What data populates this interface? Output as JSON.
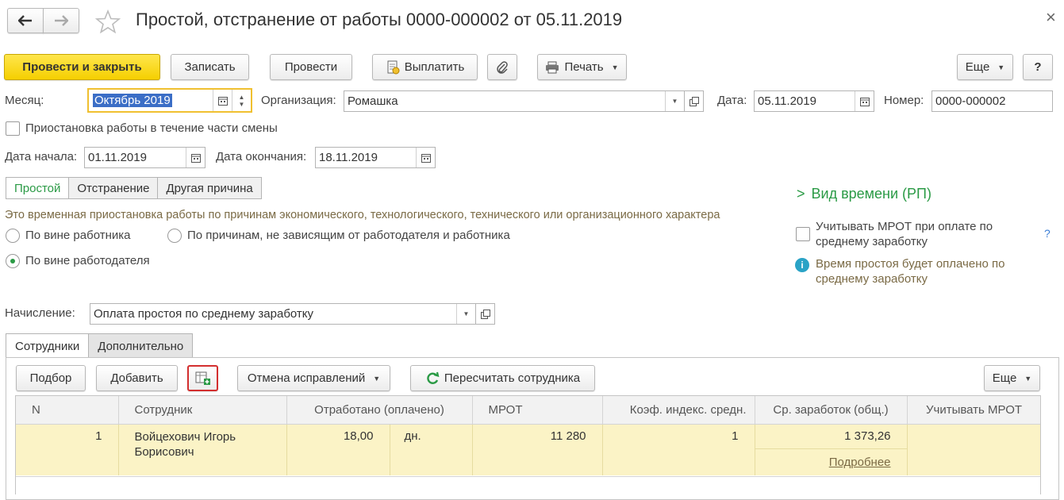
{
  "window": {
    "title": "Простой, отстранение от работы 0000-000002 от 05.11.2019",
    "back_icon": "arrow-left-icon",
    "forward_icon": "arrow-right-icon",
    "favorite_icon": "star-icon",
    "close_symbol": "×"
  },
  "toolbar": {
    "post_close": "Провести и закрыть",
    "save": "Записать",
    "post": "Провести",
    "pay": "Выплатить",
    "print": "Печать",
    "more": "Еще",
    "help": "?"
  },
  "form": {
    "month_label": "Месяц:",
    "month_value": "Октябрь 2019",
    "org_label": "Организация:",
    "org_value": "Ромашка",
    "date_label": "Дата:",
    "date_value": "05.11.2019",
    "number_label": "Номер:",
    "number_value": "0000-000002",
    "partial_shift_label": "Приостановка работы в течение части смены",
    "start_label": "Дата начала:",
    "start_value": "01.11.2019",
    "end_label": "Дата окончания:",
    "end_value": "18.11.2019"
  },
  "type_tabs": [
    "Простой",
    "Отстранение",
    "Другая причина"
  ],
  "description": "Это временная приостановка работы по причинам экономического, технологического, технического или организационного характера",
  "reasons": {
    "employee": "По вине работника",
    "independent": "По причинам, не зависящим от работодателя и работника",
    "employer": "По вине работодателя"
  },
  "right_panel": {
    "time_type": "Вид времени (РП)",
    "mrot_check_line1": "Учитывать МРОТ при оплате по",
    "mrot_check_line2": "среднему заработку",
    "help": "?",
    "info_line1": "Время простоя будет оплачено по",
    "info_line2": "среднему заработку",
    "info_symbol": "i"
  },
  "accrual": {
    "label": "Начисление:",
    "value": "Оплата простоя по среднему заработку"
  },
  "panel_tabs": [
    "Сотрудники",
    "Дополнительно"
  ],
  "table_toolbar": {
    "pick": "Подбор",
    "add": "Добавить",
    "cancel_fix": "Отмена исправлений",
    "recalc": "Пересчитать сотрудника",
    "more": "Еще"
  },
  "table": {
    "columns": [
      "N",
      "Сотрудник",
      "Отработано (оплачено)",
      "МРОТ",
      "Коэф. индекс. средн.",
      "Ср. заработок (общ.)",
      "Учитывать МРОТ"
    ],
    "rows": [
      {
        "n": "1",
        "employee_line1": "Войцехович Игорь",
        "employee_line2": "Борисович",
        "worked": "18,00",
        "unit": "дн.",
        "mrot": "11 280",
        "coef": "1",
        "avg": "1 373,26",
        "details": "Подробнее",
        "use_mrot": ""
      }
    ]
  },
  "colors": {
    "accent_green": "#2a9a45",
    "primary_yellow": "#f5cf00",
    "row_highlight": "#fbf3c6",
    "focus_border": "#f0c030",
    "selection_blue": "#3b6ec6",
    "highlight_red": "#d32f2f"
  }
}
